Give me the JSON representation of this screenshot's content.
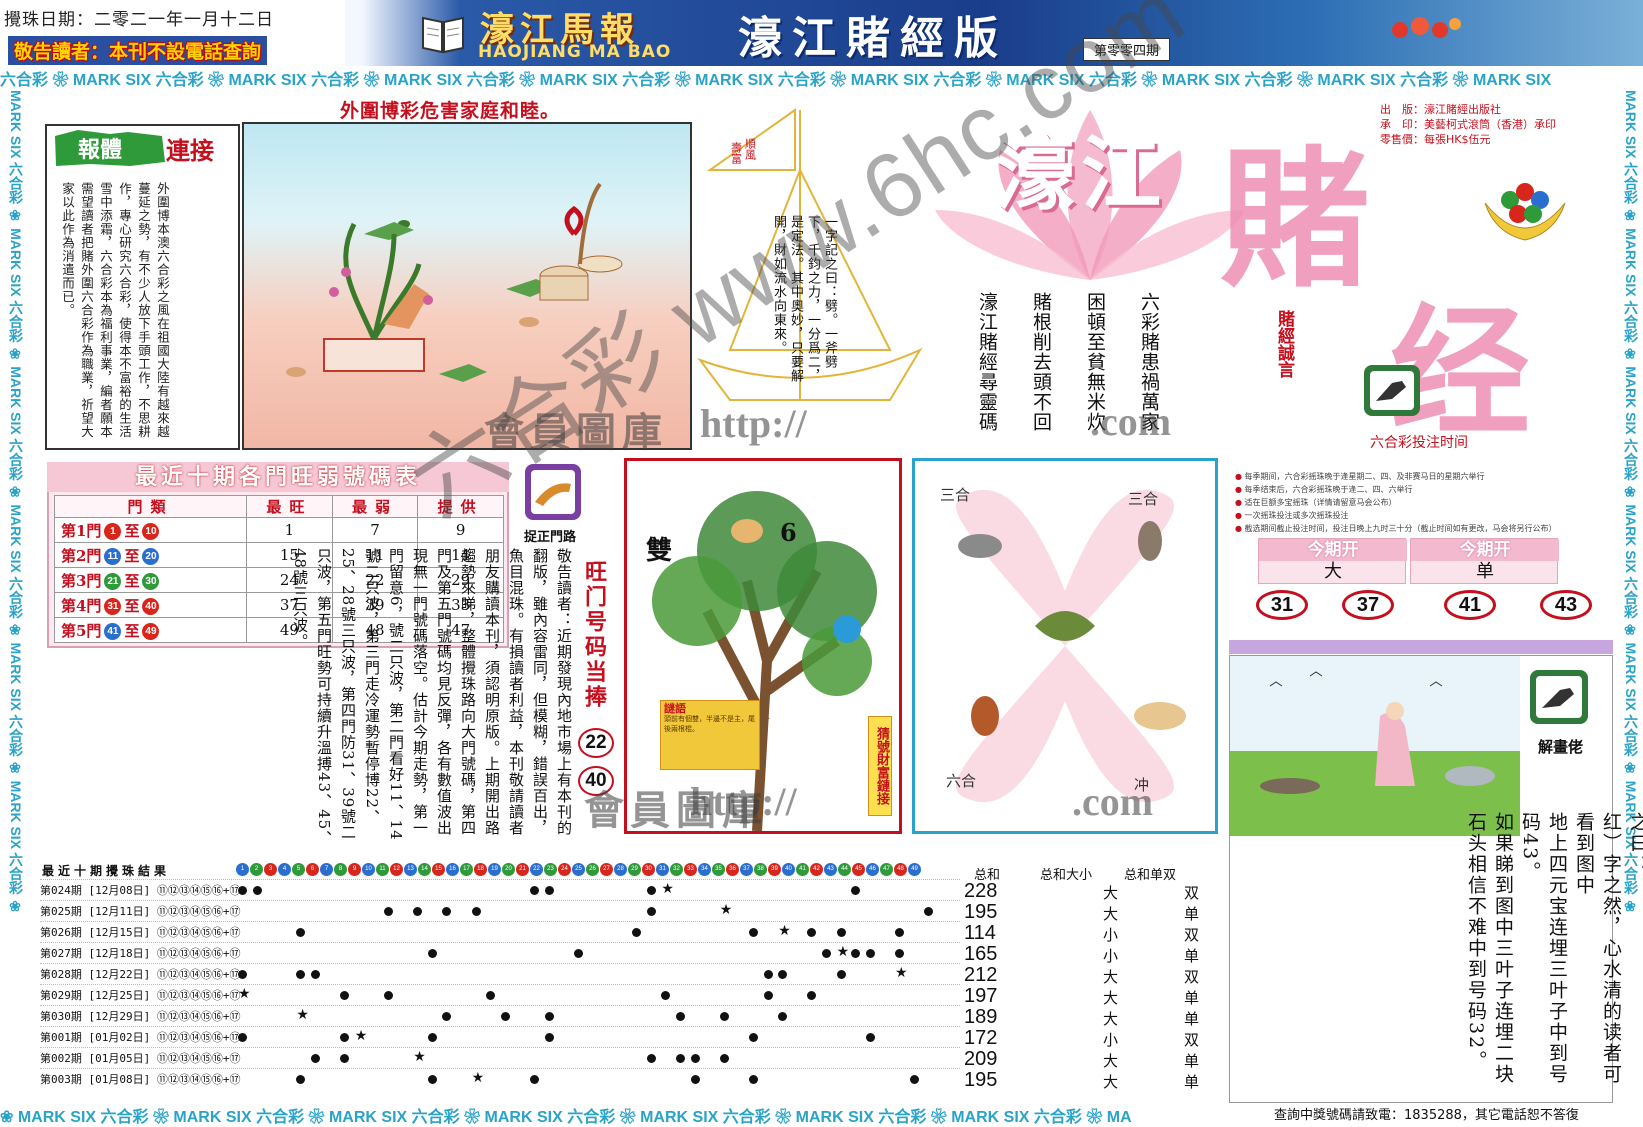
{
  "header": {
    "draw_date": "攪珠日期：二零二一年一月十二日",
    "notice": "敬告讀者：本刊不設電話查詢",
    "paper_title": "濠江馬報",
    "paper_subtitle": "HAOJIANG MA BAO",
    "edition_title": "濠江賭經版",
    "issue": "第零零四期"
  },
  "border": {
    "top_text": "六合彩 ❀ MARK SIX 六合彩 ❀ MARK SIX 六合彩 ❀ MARK SIX 六合彩 ❀ MARK SIX 六合彩 ❀ MARK SIX 六合彩 ❀ MARK SIX 六合彩 ❀ MARK SIX 六合彩 ❀ MARK SIX 六合彩 ❀ MARK SIX 六合彩 ❀ MARK SIX",
    "bottom_text": "❀ MARK SIX 六合彩 ❀ MARK SIX 六合彩 ❀ MARK SIX 六合彩 ❀ MARK SIX 六合彩 ❀ MARK SIX 六合彩 ❀ MARK SIX 六合彩 ❀ MARK SIX 六合彩 ❀ MA",
    "side_text": "MARK SIX 六合彩 ❀ MARK SIX 六合彩 ❀ MARK SIX 六合彩 ❀ MARK SIX 六合彩 ❀ MARK SIX 六合彩 ❀ MARK SIX 六合彩 ❀"
  },
  "comic": {
    "headline": "外圍博彩危害家庭和睦。",
    "badge": "報體連接",
    "serial_text": "外圍博本澳六合彩之風在祖國大陸有越來越蔓延之勢，有不少人放下手頭工作，不思耕作，專心研究六合彩，使得本不富裕的生活雪中添霜，六合彩本為福利事業，編者願本需望讀者把賭外圍六合彩作為職業，祈望大家以此作為消遣而已。"
  },
  "sail": {
    "flag": "順風壽富",
    "quote": "一字記之曰：劈。一斧劈下，千鈞之力，一分爲二，是定法。其中奧妙，只要解開，財如流水向東來。"
  },
  "masthead": {
    "title_small": "濠江",
    "title_big1": "賭",
    "title_big2": "经",
    "publisher_lines": [
      "出　版：濠江賭經出版社",
      "承　印：美藝柯式滾筒（香港）承印",
      "零售價：每張HK$伍元"
    ],
    "slogans": [
      "六彩賭患禍萬家",
      "困頓至貧無米炊",
      "賭根削去頭不回",
      "濠江賭經尋靈碼"
    ],
    "motto": "賭經誠言"
  },
  "bet_times": {
    "title": "六合彩投注时间",
    "items": [
      "每季期间，六合彩摇珠晚于逢星期二、四、及非赛马日的星期六举行",
      "每季结束后，六合彩摇珠晚于逢二、四、六举行",
      "适在巨额多宝摇珠（详情请留意马会公布）",
      "一次摇珠投注或多次摇珠投注",
      "截选期间截止投注时间，投注日晚上九时三十分（截止时间如有更改，马会将另行公布）"
    ],
    "current_label": "今期开",
    "current_values": [
      "大",
      "单"
    ],
    "numbers": [
      "31",
      "37",
      "41",
      "43"
    ]
  },
  "hotcold": {
    "title": "最近十期各門旺弱號碼表",
    "headers": [
      "門類",
      "最旺",
      "最弱",
      "提供"
    ],
    "rows": [
      {
        "door": "第1門",
        "from": "1",
        "to": "10",
        "hot": "1",
        "cold": "7",
        "pick": "9"
      },
      {
        "door": "第2門",
        "from": "11",
        "to": "20",
        "hot": "15",
        "cold": "11",
        "pick": "14"
      },
      {
        "door": "第3門",
        "from": "21",
        "to": "30",
        "hot": "24",
        "cold": "22",
        "pick": "29"
      },
      {
        "door": "第4門",
        "from": "31",
        "to": "40",
        "hot": "37",
        "cold": "39",
        "pick": "33"
      },
      {
        "door": "第5門",
        "from": "41",
        "to": "49",
        "hot": "49",
        "cold": "48",
        "pick": "47"
      }
    ],
    "separator": "至",
    "colors": {
      "red": "#d9261c",
      "green": "#2f9a3a",
      "blue": "#2a6fd0"
    }
  },
  "door_advice": {
    "label": "捉正門路",
    "text": "敬告讀者：近期發現內地市場上有本刊的翻版，雖內容雷同，但模糊，錯誤百出，魚目混珠。有損讀者利益，本刊敬請讀者朋友購讀本刊，須認明原版。上期開出路趨勢來睇，整體攪珠路向大門號碼，第四門及第五門號碼均見反彈，各有數值波出現無一門號碼落空。估計今期走勢，第一門留意6，號二只波，第二門看好11、14號二只波，第三門走冷運勢暫停博22、25、28號三只波，第四門防31、39號二只波，第五門旺勢可持續升溫搏43、45、48號三只波。",
    "hot_label": "旺门号码当捧",
    "hot_numbers": [
      "22",
      "40"
    ]
  },
  "tree": {
    "word": "雙",
    "number": "6",
    "riddle_title": "謎語",
    "riddle_text": "頭前有個雙，半邊不是主，尾後兩根棍。",
    "side_label": "猜號財富鏈接"
  },
  "zodiac": {
    "labels": [
      "三合",
      "三合",
      "六合",
      "冲"
    ]
  },
  "painting": {
    "label": "解畫佬",
    "text": [
      "上期幅寻宝图旁边诗（一字记之曰：",
      "红）字之然，心水清的读者可看到图中",
      "地上四元宝连埋三叶子中到号码43。",
      "如果睇到图中三叶子连埋二块",
      "石头相信不难中到号码32。"
    ]
  },
  "results": {
    "head": "最近十期攪珠結果",
    "sum_head": "总和",
    "bigsmall_head": "总和大小",
    "oddeven_head": "总和单双",
    "rows": [
      {
        "label": "第024期 [12月08日] ⑪⑫⑬⑭⑮⑯+⑰",
        "sum": "228",
        "big": "大",
        "odd": "双"
      },
      {
        "label": "第025期 [12月11日] ⑪⑫⑬⑭⑮⑯+⑰",
        "sum": "195",
        "big": "大",
        "odd": "单"
      },
      {
        "label": "第026期 [12月15日] ⑪⑫⑬⑭⑮⑯+⑰",
        "sum": "114",
        "big": "小",
        "odd": "双"
      },
      {
        "label": "第027期 [12月18日] ⑪⑫⑬⑭⑮⑯+⑰",
        "sum": "165",
        "big": "小",
        "odd": "单"
      },
      {
        "label": "第028期 [12月22日] ⑪⑫⑬⑭⑮⑯+⑰",
        "sum": "212",
        "big": "大",
        "odd": "双"
      },
      {
        "label": "第029期 [12月25日] ⑪⑫⑬⑭⑮⑯+⑰",
        "sum": "197",
        "big": "大",
        "odd": "单"
      },
      {
        "label": "第030期 [12月29日] ⑪⑫⑬⑭⑮⑯+⑰",
        "sum": "189",
        "big": "大",
        "odd": "单"
      },
      {
        "label": "第001期 [01月02日] ⑪⑫⑬⑭⑮⑯+⑰",
        "sum": "172",
        "big": "小",
        "odd": "双"
      },
      {
        "label": "第002期 [01月05日] ⑪⑫⑬⑭⑮⑯+⑰",
        "sum": "209",
        "big": "大",
        "odd": "单"
      },
      {
        "label": "第003期 [01月08日] ⑪⑫⑬⑭⑮⑯+⑰",
        "sum": "195",
        "big": "大",
        "odd": "单"
      }
    ]
  },
  "footer": {
    "query": "查詢中獎號碼請致電：1835288，其它電話恕不答復"
  },
  "watermarks": {
    "diagonal": "六合彩 www.6hc.com",
    "site_zh": "會員圖庫",
    "site_url": "http://",
    "site_tld": ".com"
  }
}
